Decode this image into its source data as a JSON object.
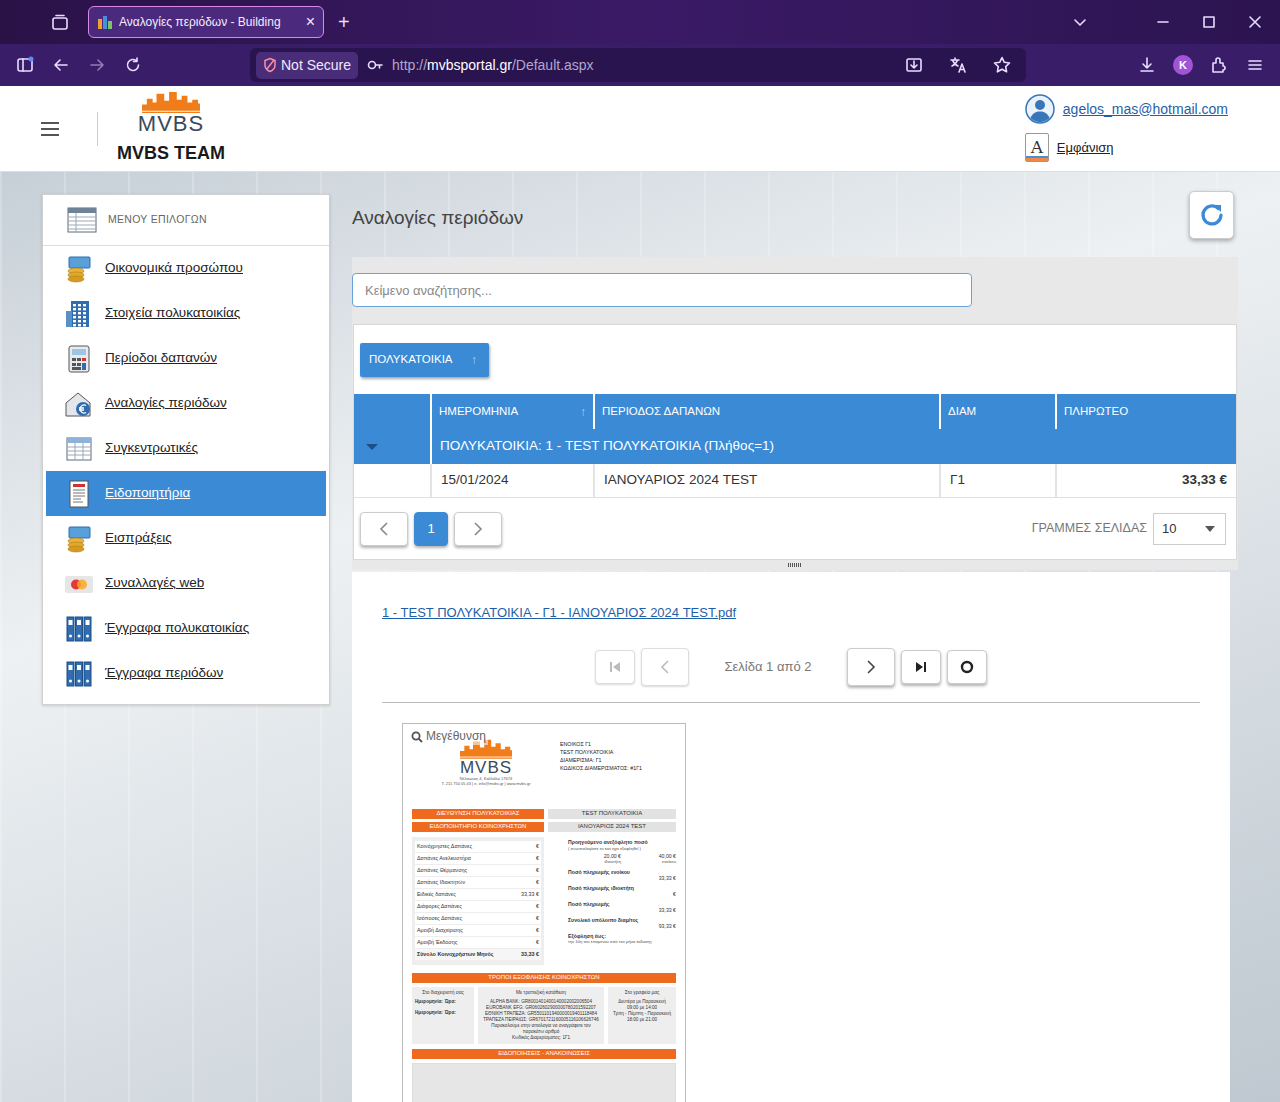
{
  "browser": {
    "tab": {
      "title": "Αναλογίες περιόδων - Building",
      "close": "×",
      "selected": true
    },
    "new_tab": "+",
    "address": {
      "security": "Not Secure",
      "scheme": "http://",
      "host": "mvbsportal.gr",
      "path": "/Default.aspx"
    },
    "profile_initial": "K"
  },
  "header": {
    "logo": "MVBS",
    "team": "MVBS TEAM",
    "user_email": "agelos_mas@hotmail.com",
    "appearance_icon": "A",
    "appearance": "Εμφάνιση"
  },
  "sidebar": {
    "title": "ΜΕΝΟΥ ΕΠΙΛΟΓΩΝ",
    "items": [
      {
        "label": "Οικονομικά προσώπου",
        "selected": false
      },
      {
        "label": "Στοιχεία πολυκατοικίας",
        "selected": false
      },
      {
        "label": "Περίοδοι δαπανών",
        "selected": false
      },
      {
        "label": "Αναλογίες περιόδων",
        "selected": false
      },
      {
        "label": "Συγκεντρωτικές",
        "selected": false
      },
      {
        "label": "Ειδοποιητήρια",
        "selected": true
      },
      {
        "label": "Εισπράξεις",
        "selected": false
      },
      {
        "label": "Συναλλαγές web",
        "selected": false
      },
      {
        "label": "Έγγραφα πολυκατοικίας",
        "selected": false
      },
      {
        "label": "Έγγραφα περιόδων",
        "selected": false
      }
    ]
  },
  "page": {
    "title": "Αναλογίες περιόδων"
  },
  "grid": {
    "search": {
      "placeholder": "Κείμενο αναζήτησης..."
    },
    "group_by": [
      {
        "label": "ΠΟΛΥΚΑΤΟΙΚΙΑ",
        "sort": "↑"
      }
    ],
    "columns": [
      {
        "label": "ΗΜΕΡΟΜΗΝΙΑ",
        "sort": "↑"
      },
      {
        "label": "ΠΕΡΙΟΔΟΣ ΔΑΠΑΝΩΝ",
        "sort": ""
      },
      {
        "label": "ΔΙΑΜ",
        "sort": ""
      },
      {
        "label": "ΠΛΗΡΩΤΕΟ",
        "sort": ""
      }
    ],
    "groups": [
      {
        "label": "ΠΟΛΥΚΑΤΟΙΚΙΑ: 1 - TEST ΠΟΛΥΚΑΤΟΙΚΙΑ (Πλήθος=1)",
        "expanded": true,
        "rows": [
          [
            "15/01/2024",
            "ΙΑΝΟΥΑΡΙΟΣ 2024 TEST",
            "Γ1",
            "33,33 €"
          ]
        ]
      }
    ],
    "pager": {
      "pages": [
        {
          "label": "1",
          "selected": true
        }
      ],
      "page_size_label": "ΓΡΑΜΜΕΣ ΣΕΛΙΔΑΣ",
      "page_size": "10"
    }
  },
  "viewer": {
    "file": "1 - TEST ΠΟΛΥΚΑΤΟΙΚΙΑ - Γ1 - ΙΑΝΟΥΑΡΙΟΣ 2024 TEST.pdf",
    "page_info": "Σελίδα 1 από 2",
    "nav": {
      "first_disabled": true,
      "prev_disabled": true,
      "next_disabled": false,
      "last_disabled": false
    },
    "zoom": "Μεγέθυνση",
    "document": {
      "logo": "MVBS",
      "company": [
        "Νέλσωνος 4, Καλλιθέα 17674",
        "T. 211 750 05 43 | e. info@mvbs.gr | www.mvbs.gr"
      ],
      "recipient": [
        "ΕΝΟΙΚΟΣ Γ1",
        "TEST ΠΟΛΥΚΑΤΟΙΚΙΑ",
        "ΔΙΑΜΕΡΙΣΜΑ: Γ1",
        "ΚΩΔΙΚΟΣ ΔΙΑΜΕΡΙΣΜΑΤΟΣ: #1Γ1"
      ],
      "info": [
        {
          "label": "ΔΙΕΥΘΥΝΣΗ ΠΟΛΥΚΑΤΟΙΚΙΑΣ",
          "value": "TEST ΠΟΛΥΚΑΤΟΙΚΙΑ"
        },
        {
          "label": "ΕΙΔΟΠΟΙΗΤΗΡΙΟ ΚΟΙΝΟΧΡΗΣΤΩΝ",
          "value": "ΙΑΝΟΥΑΡΙΟΣ 2024 TEST"
        }
      ],
      "expenses": [
        {
          "label": "Κοινόχρηστες Δαπάνες",
          "amount": "€",
          "total": false
        },
        {
          "label": "Δαπάνες Ανελκυστήρα",
          "amount": "€",
          "total": false
        },
        {
          "label": "Δαπάνες Θέρμανσης",
          "amount": "€",
          "total": false
        },
        {
          "label": "Δαπάνες Ιδιοκτητών",
          "amount": "€",
          "total": false
        },
        {
          "label": "Ειδικές δαπάνες",
          "amount": "33,33 €",
          "total": false
        },
        {
          "label": "Διάφορες Δαπάνες",
          "amount": "€",
          "total": false
        },
        {
          "label": "Ισόποσες Δαπάνες",
          "amount": "€",
          "total": false
        },
        {
          "label": "Αμοιβή Διαχείρισης",
          "amount": "€",
          "total": false
        },
        {
          "label": "Αμοιβή Έκδοσης",
          "amount": "€",
          "total": false
        },
        {
          "label": "Σύνολο Κοινοχρήστων Μηνός",
          "amount": "33,33 €",
          "total": true
        }
      ],
      "balance": {
        "title": "Προηγούμενο ανεξόφλητο ποσό",
        "note": "( συνυπολογίστε το εάν έχει εξοφληθεί )",
        "amounts": [
          {
            "value": "20,00 €",
            "label": "ιδιοκτήτη"
          },
          {
            "value": "40,00 €",
            "label": "ενοίκου"
          }
        ]
      },
      "payments": [
        {
          "label": "Ποσό πληρωμής ενοίκου",
          "value": "33,33 €",
          "kind": "amount"
        },
        {
          "label": "Ποσό πληρωμής ιδιοκτήτη",
          "value": "€",
          "kind": "amount"
        },
        {
          "label": "Ποσό πληρωμής",
          "value": "33,33 €",
          "kind": "amount"
        },
        {
          "label": "Συνολικό υπόλοιπο διαμ/τος",
          "value": "93,33 €",
          "kind": "amount"
        },
        {
          "label": "Εξόφληση έως:",
          "value": "την 10η του επόμενου από τον μήνα έκδοσης",
          "kind": "note"
        }
      ],
      "methods_title": "ΤΡΟΠΟΙ ΕΞΟΦΛΗΣΗΣ ΚΟΙΝΟΧΡΗΣΤΩΝ",
      "methods": [
        {
          "title": "Στο διαχειριστή σας",
          "kind": "form",
          "lines": [
            "Ημερομηνία:",
            "Ώρα:",
            "Ημερομηνία:",
            "Ώρα:"
          ]
        },
        {
          "title": "Με τραπεζική κατάθεση",
          "kind": "text",
          "lines": [
            "ALPHA BANK: GR8001401400140002002006504",
            "EUROBANK EFG: GR0602602900000780201592207",
            "ΕΘΝΙΚΗ ΤΡΑΠΕΖΑ: GR5501101940000019401118484",
            "ΤΡΑΠΕΖΑ ΠΕΙΡΑΙΩΣ: GR6701721160005116106626746",
            "Παρακαλούμε στην αιτιολογία να αναγράφετε τον παρακάτω αριθμό",
            "Κωδικός Διαμερίσματος: 1Γ1"
          ]
        },
        {
          "title": "Στο γραφείο μας",
          "kind": "text",
          "lines": [
            "Δευτέρα με Παρασκευή",
            "09:00 με 14:00",
            "Τρίτη - Πέμπτη - Παρασκευή",
            "18:00 με 21:00"
          ]
        }
      ],
      "notices_title": "ΕΙΔΟΠΟΙΗΣΕΙΣ - ΑΝΑΚΟΙΝΩΣΕΙΣ"
    }
  }
}
